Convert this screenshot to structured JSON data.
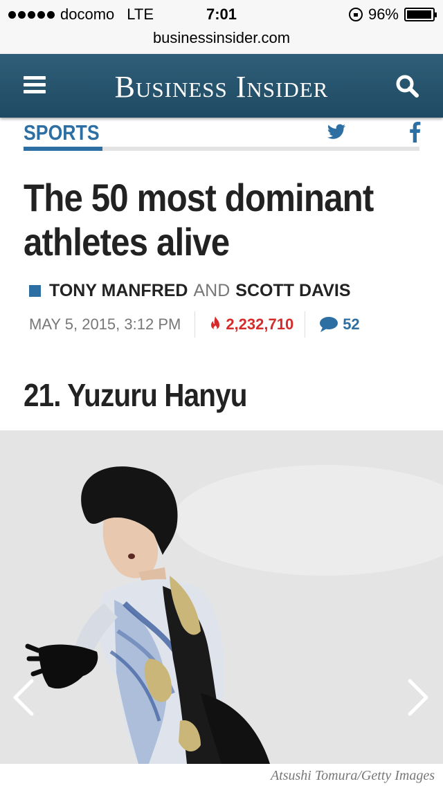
{
  "status_bar": {
    "carrier": "docomo",
    "network": "LTE",
    "time": "7:01",
    "battery": "96%",
    "battery_level": 0.96
  },
  "browser": {
    "url": "businessinsider.com"
  },
  "header": {
    "logo": "Business Insider",
    "menu_icon": "hamburger-menu-icon",
    "search_icon": "search-icon"
  },
  "section": {
    "label": "SPORTS",
    "share_icons": [
      "twitter-icon",
      "facebook-icon"
    ]
  },
  "article": {
    "headline": "The 50 most dominant athletes alive",
    "author1": "TONY MANFRED",
    "and": "AND",
    "author2": "SCOTT DAVIS",
    "date": "MAY 5, 2015, 3:12 PM",
    "views": "2,232,710",
    "comments": "52",
    "item_title": "21. Yuzuru Hanyu",
    "image_caption": "Atsushi Tomura/Getty Images"
  },
  "colors": {
    "header_bg": "#2a5670",
    "accent_blue": "#2d6fa3",
    "views_red": "#d62b2b"
  }
}
